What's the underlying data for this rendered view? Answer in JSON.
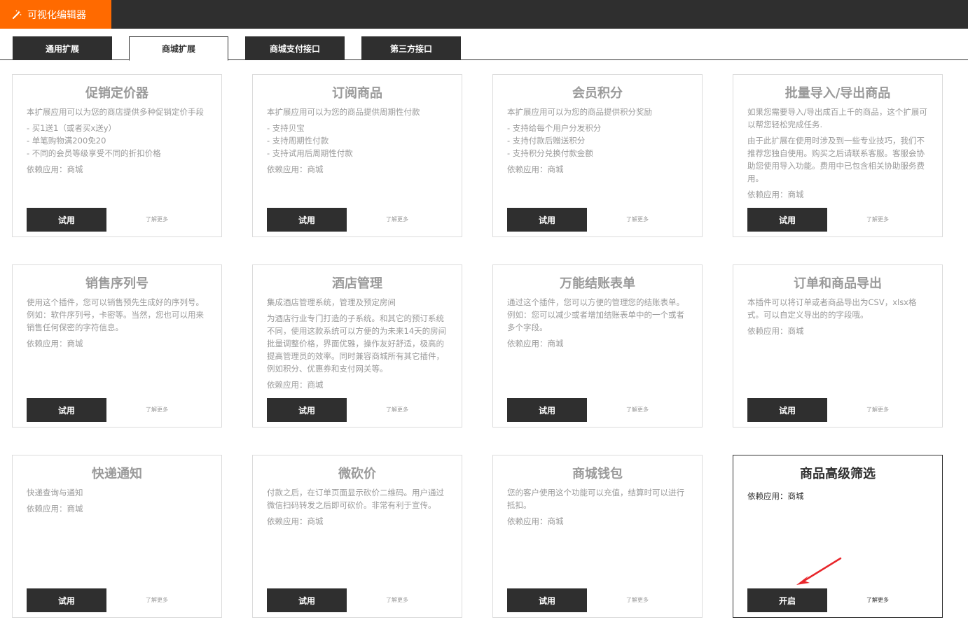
{
  "app": {
    "title": "可视化编辑器",
    "brand_color": "#ff6a00",
    "icon": "magic-wand-icon"
  },
  "tabs": [
    {
      "label": "通用扩展",
      "active": false
    },
    {
      "label": "商城扩展",
      "active": true
    },
    {
      "label": "商城支付接口",
      "active": false
    },
    {
      "label": "第三方接口",
      "active": false
    }
  ],
  "cards": [
    {
      "title": "促销定价器",
      "paras": [
        "本扩展应用可以为您的商店提供多种促销定价手段"
      ],
      "items": [
        "- 买1送1（或者买x送y）",
        "- 单笔购物满200免20",
        "- 不同的会员等级享受不同的折扣价格"
      ],
      "dep": "依赖应用：商城",
      "button": "试用",
      "more": "了解更多"
    },
    {
      "title": "订阅商品",
      "paras": [
        "本扩展应用可以为您的商品提供周期性付款"
      ],
      "items": [
        "- 支持贝宝",
        "- 支持周期性付款",
        "- 支持试用后周期性付款"
      ],
      "dep": "依赖应用：商城",
      "button": "试用",
      "more": "了解更多"
    },
    {
      "title": "会员积分",
      "paras": [
        "本扩展应用可以为您的商品提供积分奖励"
      ],
      "items": [
        "- 支持给每个用户分发积分",
        "- 支持付款后赠送积分",
        "- 支持积分兑换付款金额"
      ],
      "dep": "依赖应用：商城",
      "button": "试用",
      "more": "了解更多"
    },
    {
      "title": "批量导入/导出商品",
      "paras": [
        "如果您需要导入/导出成百上千的商品，这个扩展可以帮您轻松完成任务.",
        "由于此扩展在使用时涉及到一些专业技巧，我们不推荐您独自使用。购买之后请联系客服。客服会协助您使用导入功能。费用中已包含相关协助服务费用。"
      ],
      "items": [],
      "dep": "依赖应用：商城",
      "button": "试用",
      "more": "了解更多"
    },
    {
      "title": "销售序列号",
      "paras": [
        "使用这个插件，您可以销售预先生成好的序列号。例如：软件序列号，卡密等。当然，您也可以用来销售任何保密的字符信息。"
      ],
      "items": [],
      "dep": "依赖应用：商城",
      "button": "试用",
      "more": "了解更多"
    },
    {
      "title": "酒店管理",
      "paras": [
        "集成酒店管理系统，管理及预定房间",
        "为酒店行业专门打造的子系统。和其它的预订系统不同，使用这款系统可以方便的为未来14天的房间批量调整价格，界面优雅，操作友好舒适，极高的提高管理员的效率。同时兼容商城所有其它插件，例如积分、优惠券和支付网关等。"
      ],
      "items": [],
      "dep": "依赖应用：商城",
      "button": "试用",
      "more": "了解更多"
    },
    {
      "title": "万能结账表单",
      "paras": [
        "通过这个插件，您可以方便的管理您的结账表单。例如：您可以减少或者增加结账表单中的一个或者多个字段。"
      ],
      "items": [],
      "dep": "依赖应用：商城",
      "button": "试用",
      "more": "了解更多"
    },
    {
      "title": "订单和商品导出",
      "paras": [
        "本插件可以将订单或者商品导出为CSV，xlsx格式。可以自定义导出的的字段哦。"
      ],
      "items": [],
      "dep": "依赖应用：商城",
      "button": "试用",
      "more": "了解更多"
    },
    {
      "title": "快递通知",
      "paras": [
        "快递查询与通知"
      ],
      "items": [],
      "dep": "依赖应用：商城",
      "button": "试用",
      "more": "了解更多"
    },
    {
      "title": "微砍价",
      "paras": [
        "付款之后，在订单页面显示砍价二维码。用户通过微信扫码转发之后即可砍价。非常有利于宣传。"
      ],
      "items": [],
      "dep": "依赖应用：商城",
      "button": "试用",
      "more": "了解更多"
    },
    {
      "title": "商城钱包",
      "paras": [
        "您的客户使用这个功能可以充值，结算时可以进行抵扣。"
      ],
      "items": [],
      "dep": "依赖应用：商城",
      "button": "试用",
      "more": "了解更多"
    },
    {
      "title": "商品高级筛选",
      "paras": [],
      "items": [],
      "dep": "依赖应用：商城",
      "button": "开启",
      "more": "了解更多",
      "active": true
    }
  ],
  "annotation": {
    "icon": "pointer-arrow-icon",
    "color": "#e8262b"
  }
}
